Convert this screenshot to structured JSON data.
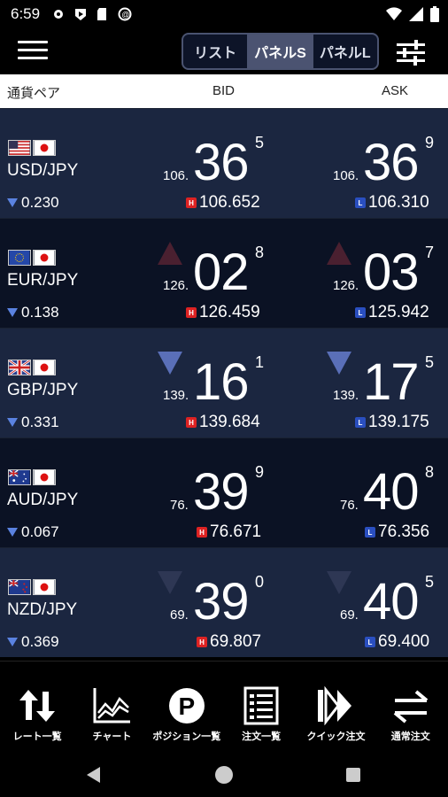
{
  "status": {
    "time": "6:59"
  },
  "header": {
    "tabs": [
      {
        "label": "リスト",
        "active": false
      },
      {
        "label": "パネルS",
        "active": true
      },
      {
        "label": "パネルL",
        "active": false
      }
    ]
  },
  "columns": {
    "pair": "通貨ペア",
    "bid": "BID",
    "ask": "ASK"
  },
  "rows": [
    {
      "pair": "USD/JPY",
      "change": "0.230",
      "bid": {
        "pre": "106.",
        "big": "36",
        "sup": "5",
        "high": "106.652"
      },
      "ask": {
        "pre": "106.",
        "big": "36",
        "sup": "9",
        "low": "106.310"
      }
    },
    {
      "pair": "EUR/JPY",
      "change": "0.138",
      "bid": {
        "pre": "126.",
        "big": "02",
        "sup": "8",
        "high": "126.459"
      },
      "ask": {
        "pre": "126.",
        "big": "03",
        "sup": "7",
        "low": "125.942"
      }
    },
    {
      "pair": "GBP/JPY",
      "change": "0.331",
      "bid": {
        "pre": "139.",
        "big": "16",
        "sup": "1",
        "high": "139.684"
      },
      "ask": {
        "pre": "139.",
        "big": "17",
        "sup": "5",
        "low": "139.175"
      }
    },
    {
      "pair": "AUD/JPY",
      "change": "0.067",
      "bid": {
        "pre": "76.",
        "big": "39",
        "sup": "9",
        "high": "76.671"
      },
      "ask": {
        "pre": "76.",
        "big": "40",
        "sup": "8",
        "low": "76.356"
      }
    },
    {
      "pair": "NZD/JPY",
      "change": "0.369",
      "bid": {
        "pre": "69.",
        "big": "39",
        "sup": "0",
        "high": "69.807"
      },
      "ask": {
        "pre": "69.",
        "big": "40",
        "sup": "5",
        "low": "69.400"
      }
    }
  ],
  "badges": {
    "high": "H",
    "low": "L"
  },
  "toolbar": [
    {
      "label": "レート一覧",
      "icon": "rate-list-icon"
    },
    {
      "label": "チャート",
      "icon": "chart-icon"
    },
    {
      "label": "ポジション一覧",
      "icon": "position-icon"
    },
    {
      "label": "注文一覧",
      "icon": "order-list-icon"
    },
    {
      "label": "クイック注文",
      "icon": "quick-order-icon"
    },
    {
      "label": "通常注文",
      "icon": "normal-order-icon"
    }
  ],
  "position_icon_letter": "P"
}
